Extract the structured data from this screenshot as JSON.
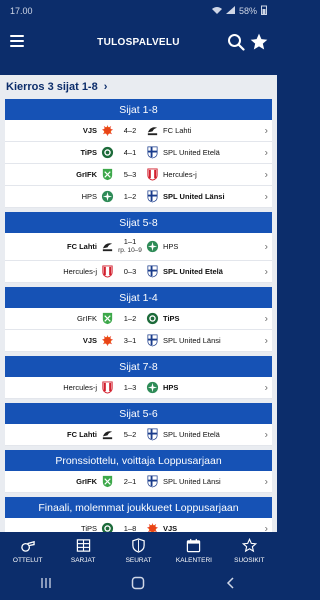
{
  "status": {
    "time": "17.00",
    "battery": "58%"
  },
  "app": {
    "title": "TULOSPALVELU"
  },
  "round": {
    "title": "Kierros 3 sijat 1-8",
    "chevron": "›"
  },
  "sections": [
    {
      "title": "Sijat 1-8",
      "matches": [
        {
          "home": "VJS",
          "home_bold": true,
          "score": "4–2",
          "away": "FC Lahti",
          "away_bold": false,
          "hl": "vjs",
          "al": "fclahti"
        },
        {
          "home": "TiPS",
          "home_bold": true,
          "score": "4–1",
          "away": "SPL United Etelä",
          "away_bold": false,
          "hl": "tips",
          "al": "spl"
        },
        {
          "home": "GrIFK",
          "home_bold": true,
          "score": "5–3",
          "away": "Hercules-j",
          "away_bold": false,
          "hl": "grifk",
          "al": "hercules"
        },
        {
          "home": "HPS",
          "home_bold": false,
          "score": "1–2",
          "away": "SPL United Länsi",
          "away_bold": true,
          "hl": "hps",
          "al": "spl"
        }
      ]
    },
    {
      "title": "Sijat 5-8",
      "matches": [
        {
          "home": "FC Lahti",
          "home_bold": true,
          "score": "1–1",
          "score_sub": "rp. 10–9",
          "away": "HPS",
          "away_bold": false,
          "hl": "fclahti",
          "al": "hps"
        },
        {
          "home": "Hercules-j",
          "home_bold": false,
          "score": "0–3",
          "away": "SPL United Etelä",
          "away_bold": true,
          "hl": "hercules",
          "al": "spl"
        }
      ]
    },
    {
      "title": "Sijat 1-4",
      "matches": [
        {
          "home": "GrIFK",
          "home_bold": false,
          "score": "1–2",
          "away": "TiPS",
          "away_bold": true,
          "hl": "grifk",
          "al": "tips"
        },
        {
          "home": "VJS",
          "home_bold": true,
          "score": "3–1",
          "away": "SPL United Länsi",
          "away_bold": false,
          "hl": "vjs",
          "al": "spl"
        }
      ]
    },
    {
      "title": "Sijat 7-8",
      "matches": [
        {
          "home": "Hercules-j",
          "home_bold": false,
          "score": "1–3",
          "away": "HPS",
          "away_bold": true,
          "hl": "hercules",
          "al": "hps"
        }
      ]
    },
    {
      "title": "Sijat 5-6",
      "matches": [
        {
          "home": "FC Lahti",
          "home_bold": true,
          "score": "5–2",
          "away": "SPL United Etelä",
          "away_bold": false,
          "hl": "fclahti",
          "al": "spl"
        }
      ]
    },
    {
      "title": "Pronssiottelu, voittaja Loppusarjaan",
      "matches": [
        {
          "home": "GrIFK",
          "home_bold": true,
          "score": "2–1",
          "away": "SPL United Länsi",
          "away_bold": false,
          "hl": "grifk",
          "al": "spl"
        }
      ]
    },
    {
      "title": "Finaali, molemmat joukkueet Loppusarjaan",
      "matches": [
        {
          "home": "TiPS",
          "home_bold": false,
          "score": "1–8",
          "away": "VJS",
          "away_bold": true,
          "hl": "tips",
          "al": "vjs"
        }
      ]
    }
  ],
  "nav": [
    {
      "label": "OTTELUT",
      "icon": "whistle-icon"
    },
    {
      "label": "SARJAT",
      "icon": "table-icon"
    },
    {
      "label": "SEURAT",
      "icon": "shield-icon"
    },
    {
      "label": "KALENTERI",
      "icon": "calendar-icon"
    },
    {
      "label": "SUOSIKIT",
      "icon": "star-icon"
    }
  ],
  "colors": {
    "primary": "#0c2d6b",
    "section": "#1652b5",
    "background": "#e9ecf1"
  }
}
